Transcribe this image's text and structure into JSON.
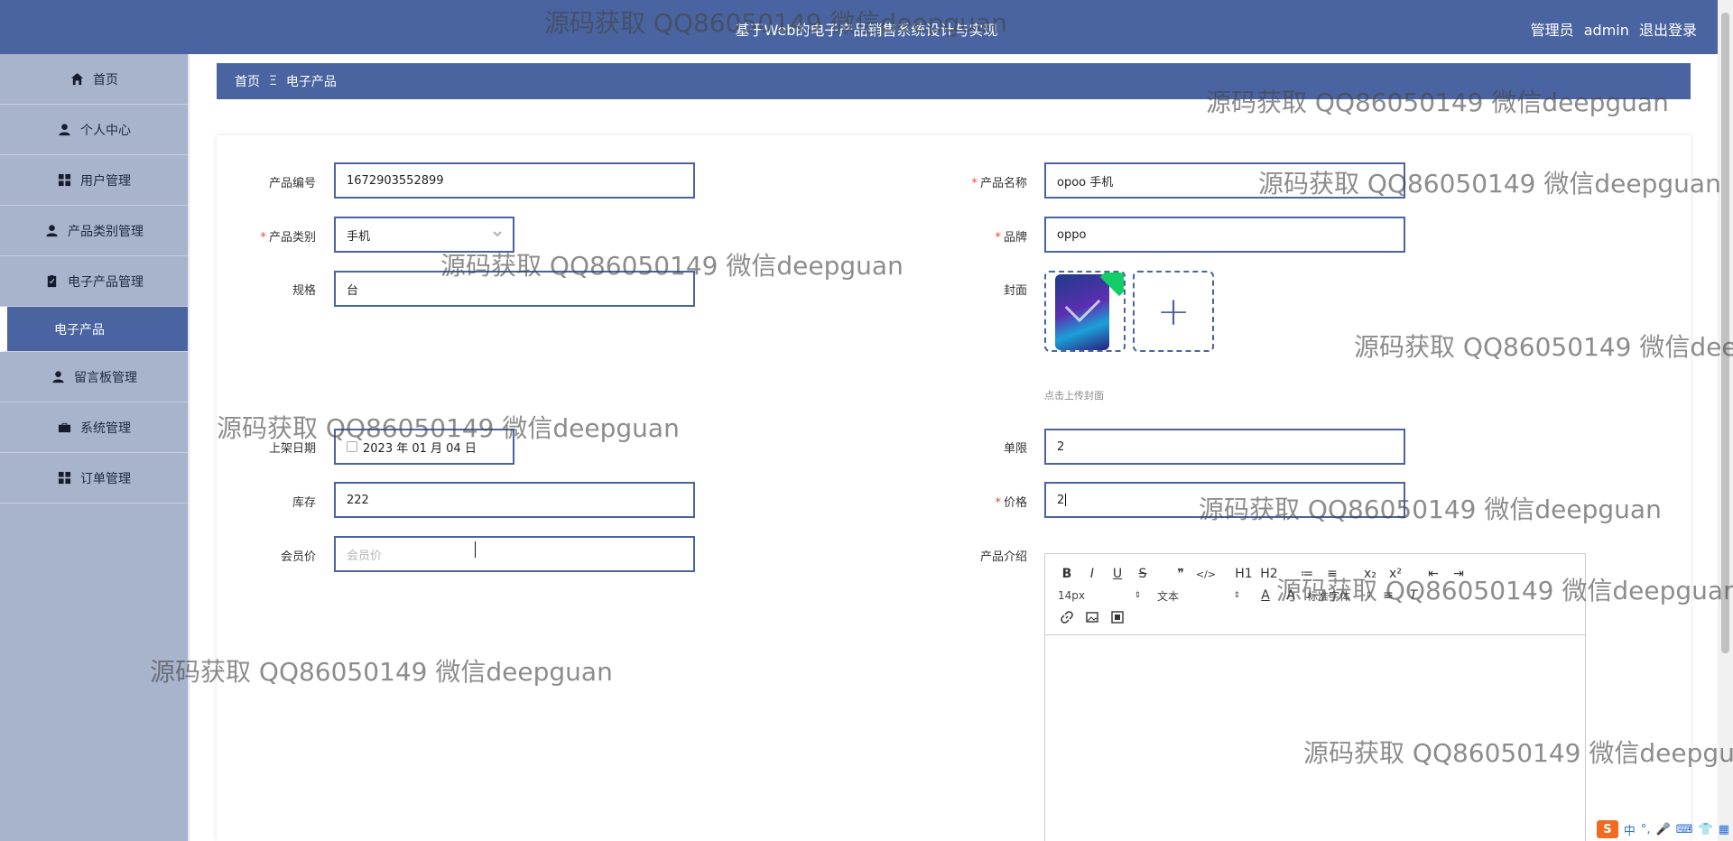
{
  "header": {
    "title": "基于Web的电子产品销售系统设计与实现",
    "role": "管理员",
    "username": "admin",
    "logout_label": "退出登录"
  },
  "sidebar": {
    "items": [
      {
        "label": "首页",
        "icon": "home-icon"
      },
      {
        "label": "个人中心",
        "icon": "user-icon"
      },
      {
        "label": "用户管理",
        "icon": "grid-icon"
      },
      {
        "label": "产品类别管理",
        "icon": "user-icon"
      },
      {
        "label": "电子产品管理",
        "icon": "clipboard-icon"
      },
      {
        "label": "电子产品",
        "active": true
      },
      {
        "label": "留言板管理",
        "icon": "user-icon"
      },
      {
        "label": "系统管理",
        "icon": "briefcase-icon"
      },
      {
        "label": "订单管理",
        "icon": "grid-icon"
      }
    ]
  },
  "breadcrumb": {
    "home": "首页",
    "separator": "Ξ",
    "current": "电子产品"
  },
  "form": {
    "product_code": {
      "label": "产品编号",
      "value": "1672903552899"
    },
    "product_name": {
      "label": "产品名称",
      "value": "opoo 手机",
      "required": true
    },
    "category": {
      "label": "产品类别",
      "value": "手机",
      "required": true
    },
    "brand": {
      "label": "品牌",
      "value": "oppo",
      "required": true
    },
    "spec": {
      "label": "规格",
      "value": "台"
    },
    "cover": {
      "label": "封面",
      "hint": "点击上传封面",
      "upload_icon": "+"
    },
    "listing_date": {
      "label": "上架日期",
      "value": "2023 年 01 月 04 日"
    },
    "limit": {
      "label": "单限",
      "value": "2"
    },
    "stock": {
      "label": "库存",
      "value": "222"
    },
    "price": {
      "label": "价格",
      "value": "2",
      "required": true
    },
    "member_price": {
      "label": "会员价",
      "placeholder": "会员价",
      "value": ""
    },
    "description": {
      "label": "产品介绍"
    }
  },
  "editor": {
    "row1": [
      "B",
      "I",
      "U",
      "S",
      "❞",
      "</>",
      "H1",
      "H2",
      "≔",
      "≡",
      "x₂",
      "x²",
      "⇤",
      "⇥"
    ],
    "font_size": "14px",
    "text_style": "文本",
    "font_family": "标准字体",
    "row3_icons": [
      "link-icon",
      "image-icon",
      "video-icon"
    ]
  },
  "watermark": {
    "text": "源码获取 QQ86050149 微信deepguan"
  },
  "ime": {
    "logo": "S",
    "items": [
      "中",
      "°,",
      "🎤",
      "⌨",
      "👕",
      "▦"
    ]
  },
  "colors": {
    "primary": "#4964a0",
    "sidebar_bg": "#a8b3cc",
    "required": "#e0483b"
  }
}
